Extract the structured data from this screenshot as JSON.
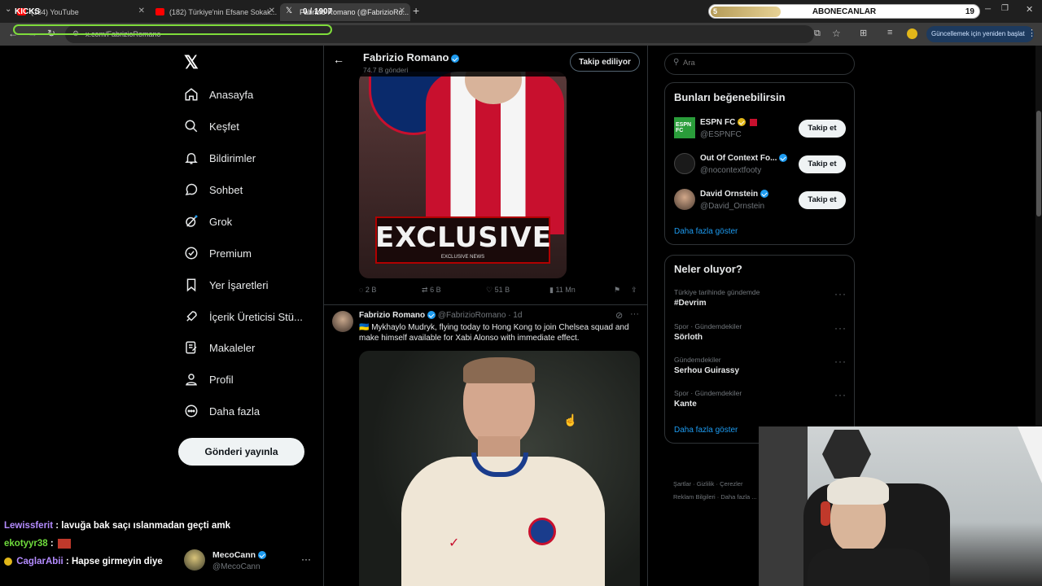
{
  "browser": {
    "tabs": [
      {
        "label": "(184) YouTube"
      },
      {
        "label": "(182) Türkiye'nin Efsane Sokak..."
      },
      {
        "label": "Fabrizio Romano (@FabrizioRo..."
      }
    ],
    "kicks_label": "KICKS",
    "kicks_count": "0 / 1907",
    "url": "x.com/FabrizioRomano",
    "update_button": "Güncellemek için yeniden başlat"
  },
  "overlay": {
    "title": "ABONECANLAR",
    "current": "5",
    "goal": "19",
    "progress": 0.26
  },
  "nav": {
    "items": [
      {
        "label": "Anasayfa",
        "icon": "home-icon"
      },
      {
        "label": "Keşfet",
        "icon": "search-icon"
      },
      {
        "label": "Bildirimler",
        "icon": "bell-icon"
      },
      {
        "label": "Sohbet",
        "icon": "chat-icon"
      },
      {
        "label": "Grok",
        "icon": "grok-icon"
      },
      {
        "label": "Premium",
        "icon": "premium-icon"
      },
      {
        "label": "Yer İşaretleri",
        "icon": "bookmark-icon"
      },
      {
        "label": "İçerik Üreticisi Stü...",
        "icon": "rocket-icon"
      },
      {
        "label": "Makaleler",
        "icon": "article-icon"
      },
      {
        "label": "Profil",
        "icon": "profile-icon"
      },
      {
        "label": "Daha fazla",
        "icon": "more-circle-icon"
      }
    ],
    "post_button": "Gönderi yayınla"
  },
  "account": {
    "name": "MecoCann",
    "handle": "@MecoCann"
  },
  "chat": [
    {
      "user": "Lewissferit",
      "message": ": lavuğa bak saçı ıslanmadan geçti amk",
      "color": "#b48cff"
    },
    {
      "user": "ekotyyr38",
      "message": ":",
      "color": "#6fdc3c"
    },
    {
      "user": "CaglarAbii",
      "message": ": Hapse girmeyin diye",
      "color": "#b48cff"
    }
  ],
  "profile_header": {
    "name": "Fabrizio Romano",
    "posts": "74.7 B gönderi",
    "follow_state": "Takip ediliyor"
  },
  "first_post": {
    "image_text": "EXCLUSIVE",
    "image_subtext": "EXCLUSIVE NEWS",
    "replies": "2 B",
    "reposts": "6 B",
    "likes": "51 B",
    "views": "11 Mn"
  },
  "second_post": {
    "name": "Fabrizio Romano",
    "handle": "@FabrizioRomano",
    "time": "· 1d",
    "text": "🇺🇦 Mykhaylo Mudryk, flying today to Hong Kong to join Chelsea squad and make himself available for Xabi Alonso with immediate effect."
  },
  "search": {
    "placeholder": "Ara"
  },
  "suggestions": {
    "title": "Bunları beğenebilirsin",
    "items": [
      {
        "name": "ESPN FC",
        "handle": "@ESPNFC",
        "button": "Takip et"
      },
      {
        "name": "Out Of Context Fo...",
        "handle": "@nocontextfooty",
        "button": "Takip et"
      },
      {
        "name": "David Ornstein",
        "handle": "@David_Ornstein",
        "button": "Takip et"
      }
    ],
    "show_more": "Daha fazla göster"
  },
  "trends": {
    "title": "Neler oluyor?",
    "items": [
      {
        "context": "Türkiye tarihinde gündemde",
        "topic": "#Devrim"
      },
      {
        "context": "Spor · Gündemdekiler",
        "topic": "Sörloth"
      },
      {
        "context": "Gündemdekiler",
        "topic": "Serhou Guirassy"
      },
      {
        "context": "Spor · Gündemdekiler",
        "topic": "Kante"
      }
    ],
    "show_more": "Daha fazla göster"
  },
  "footer": {
    "links": [
      "Şartlar",
      "Gizlilik",
      "Çerezler",
      "Reklam Bilgileri",
      "Daha fazla ..."
    ]
  },
  "colors": {
    "accent": "#1d9bf0",
    "background": "#000000",
    "border": "#2f3336",
    "muted": "#71767b"
  }
}
